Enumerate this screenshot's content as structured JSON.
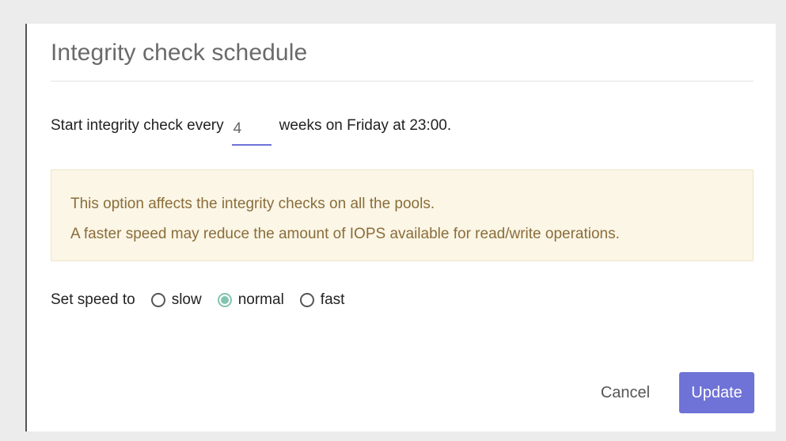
{
  "dialog": {
    "title": "Integrity check schedule",
    "schedule": {
      "prefix": "Start integrity check every",
      "interval_value": "4",
      "suffix": "weeks on Friday at 23:00."
    },
    "info": {
      "line1": "This option affects the integrity checks on all the pools.",
      "line2": "A faster speed may reduce the amount of IOPS available for read/write operations."
    },
    "speed": {
      "label": "Set speed to",
      "options": [
        {
          "label": "slow",
          "checked": false
        },
        {
          "label": "normal",
          "checked": true
        },
        {
          "label": "fast",
          "checked": false
        }
      ]
    },
    "buttons": {
      "cancel": "Cancel",
      "update": "Update"
    }
  },
  "colors": {
    "accent": "#6f72d6",
    "radio_checked": "#82c4b0",
    "info_background": "#fbf6e6",
    "info_text": "#8a6d3b"
  }
}
